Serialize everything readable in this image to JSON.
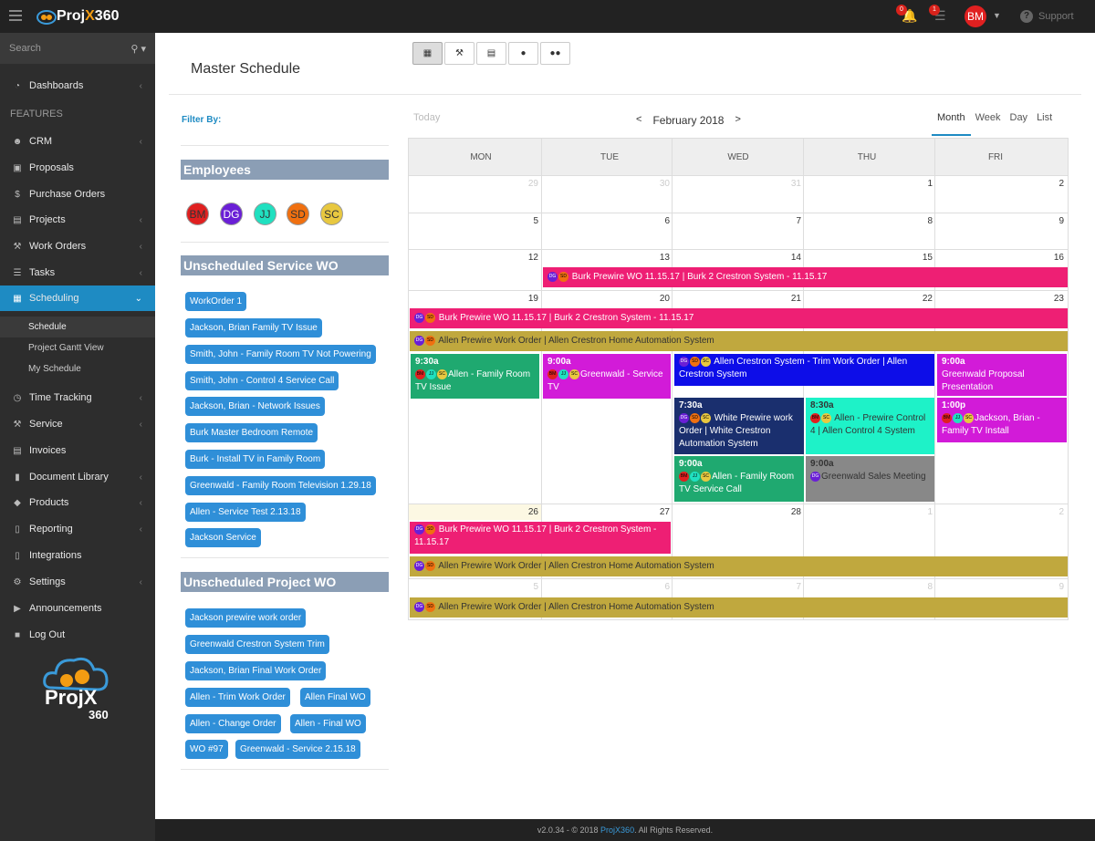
{
  "app": {
    "name_a": "Proj",
    "name_x": "X",
    "name_b": "360"
  },
  "topbar": {
    "notif_badge": "0",
    "tasks_badge": "1",
    "user_initials": "BM",
    "support": "Support"
  },
  "sidebar": {
    "search_placeholder": "Search",
    "dashboards": "Dashboards",
    "features_label": "FEATURES",
    "items": [
      {
        "label": "CRM"
      },
      {
        "label": "Proposals"
      },
      {
        "label": "Purchase Orders"
      },
      {
        "label": "Projects"
      },
      {
        "label": "Work Orders"
      },
      {
        "label": "Tasks"
      },
      {
        "label": "Scheduling"
      }
    ],
    "sub": [
      {
        "label": "Schedule"
      },
      {
        "label": "Project Gantt View"
      },
      {
        "label": "My Schedule"
      }
    ],
    "items2": [
      {
        "label": "Time Tracking"
      },
      {
        "label": "Service"
      },
      {
        "label": "Invoices"
      },
      {
        "label": "Document Library"
      },
      {
        "label": "Products"
      },
      {
        "label": "Reporting"
      },
      {
        "label": "Integrations"
      },
      {
        "label": "Settings"
      },
      {
        "label": "Announcements"
      },
      {
        "label": "Log Out"
      }
    ],
    "logo_text": "ProjX",
    "logo_num": "360"
  },
  "page": {
    "title": "Master Schedule",
    "filter_by": "Filter By:",
    "employees_header": "Employees",
    "employees": [
      {
        "initials": "BM",
        "color": "#e02020"
      },
      {
        "initials": "DG",
        "color": "#6a1fd6"
      },
      {
        "initials": "JJ",
        "color": "#20e0c0"
      },
      {
        "initials": "SD",
        "color": "#f07010"
      },
      {
        "initials": "SC",
        "color": "#e8c840"
      }
    ],
    "service_header": "Unscheduled Service WO",
    "service_wo": [
      "WorkOrder 1",
      "Jackson, Brian Family TV Issue",
      "Smith, John - Family Room TV Not Powering",
      "Smith, John - Control 4 Service Call",
      "Jackson, Brian - Network Issues",
      "Burk Master Bedroom Remote",
      "Burk - Install TV in Family Room",
      "Greenwald - Family Room Television 1.29.18",
      "Allen - Service Test 2.13.18",
      "Jackson Service"
    ],
    "project_header": "Unscheduled Project WO",
    "project_wo": [
      "Jackson prewire work order",
      "Greenwald Crestron System Trim",
      "Jackson, Brian Final Work Order",
      "Allen - Trim Work Order",
      "Allen Final WO",
      "Allen - Change Order",
      "Allen - Final WO",
      "WO #97",
      "Greenwald - Service 2.15.18"
    ]
  },
  "calendar": {
    "today": "Today",
    "prev": "<",
    "month_label": "February 2018",
    "next": ">",
    "views": [
      "Month",
      "Week",
      "Day",
      "List"
    ],
    "active_view": "Month",
    "days": [
      "MON",
      "TUE",
      "WED",
      "THU",
      "FRI"
    ],
    "weeks": [
      [
        "29",
        "30",
        "31",
        "1",
        "2"
      ],
      [
        "5",
        "6",
        "7",
        "8",
        "9"
      ],
      [
        "12",
        "13",
        "14",
        "15",
        "16"
      ],
      [
        "19",
        "20",
        "21",
        "22",
        "23"
      ],
      [
        "26",
        "27",
        "28",
        "1",
        "2"
      ],
      [
        "5",
        "6",
        "7",
        "8",
        "9"
      ]
    ],
    "events": {
      "burk_prewire": "Burk Prewire WO 11.15.17 | Burk 2 Crestron System - 11.15.17",
      "allen_prewire": "Allen Prewire Work Order | Allen Crestron Home Automation System",
      "e1_time": "9:30a",
      "e1_text": "Allen - Family Room TV Issue",
      "e2_time": "9:00a",
      "e2_text": "Greenwald - Service TV",
      "e3_text": "Allen Crestron System - Trim Work Order | Allen Crestron System",
      "e4_time": "9:00a",
      "e4_text": "Greenwald Proposal Presentation",
      "e5_time": "7:30a",
      "e5_text": "White Prewire work Order | White Crestron Automation System",
      "e6_time": "8:30a",
      "e6_text": "Allen - Prewire Control 4 | Allen Control 4 System",
      "e7_time": "1:00p",
      "e7_text": "Jackson, Brian - Family TV Install",
      "e8_time": "9:00a",
      "e8_text": "Allen - Family Room TV Service Call",
      "e9_time": "9:00a",
      "e9_text": "Greenwald Sales Meeting"
    },
    "colors": {
      "pink": "#ee1f74",
      "olive": "#c0a83e",
      "green": "#1fa970",
      "magenta": "#d21bd8",
      "blue": "#0d0de8",
      "navy": "#1a2f6e",
      "teal": "#1ef2c8",
      "gray": "#888888"
    }
  },
  "footer": {
    "version": "v2.0.34 - © 2018 ",
    "brand": "ProjX360",
    "rights": ". All Rights Reserved."
  }
}
